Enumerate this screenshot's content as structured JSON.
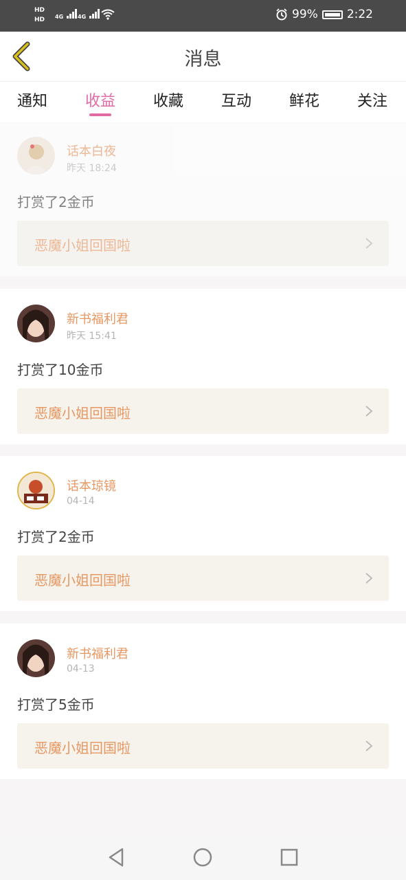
{
  "status_bar": {
    "network": [
      "HD",
      "HD",
      "4G",
      "4G"
    ],
    "battery_percent": "99%",
    "time": "2:22",
    "icons": [
      "alarm-icon",
      "wifi-icon",
      "battery-icon"
    ]
  },
  "header": {
    "title": "消息",
    "back_icon": "chevron-left-icon"
  },
  "tabs": [
    {
      "label": "通知"
    },
    {
      "label": "收益",
      "active": true
    },
    {
      "label": "收藏"
    },
    {
      "label": "互动"
    },
    {
      "label": "鲜花"
    },
    {
      "label": "关注"
    }
  ],
  "messages": [
    {
      "name": "话本白夜",
      "time": "昨天 18:24",
      "action": "打赏了2金币",
      "book": "恶魔小姐回国啦"
    },
    {
      "name": "新书福利君",
      "time": "昨天 15:41",
      "action": "打赏了10金币",
      "book": "恶魔小姐回国啦"
    },
    {
      "name": "话本琼镜",
      "time": "04-14",
      "action": "打赏了2金币",
      "book": "恶魔小姐回国啦"
    },
    {
      "name": "新书福利君",
      "time": "04-13",
      "action": "打赏了5金币",
      "book": "恶魔小姐回国啦"
    }
  ],
  "colors": {
    "accent": "#e26aa5",
    "name": "#e79762",
    "book_bg": "#f5f3ec",
    "back_icon": "#d8c11a"
  },
  "nav_icons": [
    "back-triangle-icon",
    "home-circle-icon",
    "recents-square-icon"
  ]
}
